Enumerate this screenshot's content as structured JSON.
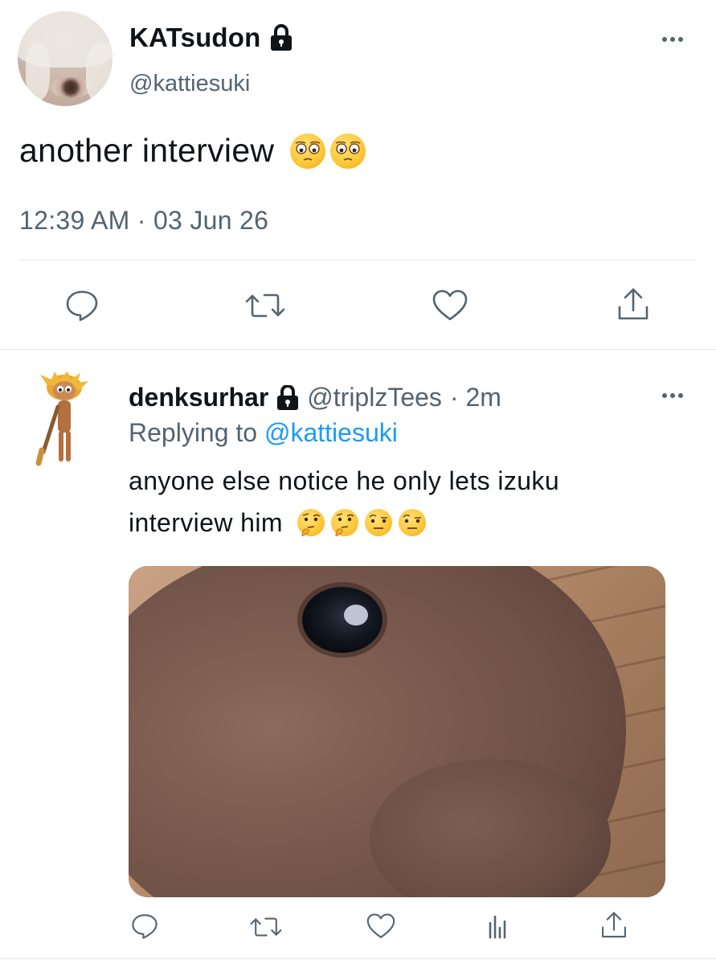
{
  "main_tweet": {
    "display_name": "KATsudon",
    "handle": "@kattiesuki",
    "text": "another interview",
    "emojis": [
      "flushed-face",
      "flushed-face"
    ],
    "timestamp": "12:39 AM · 03 Jun 26",
    "protected": true
  },
  "reply_tweet": {
    "display_name": "denksurhar",
    "handle": "@triplzTees",
    "time": "· 2m",
    "replying_prefix": "Replying to",
    "replying_to": "@kattiesuki",
    "text_line1": "anyone else notice he only lets izuku",
    "text_line2": "interview him",
    "emojis": [
      "thinking-face",
      "thinking-face",
      "raised-eyebrow-face",
      "raised-eyebrow-face"
    ],
    "protected": true
  },
  "colors": {
    "text": "#0f1419",
    "secondary": "#536471",
    "link": "#1d9bf0",
    "divider": "#e1e6ea"
  },
  "icons": {
    "main_actions": [
      "reply-icon",
      "retweet-icon",
      "like-icon",
      "share-icon"
    ],
    "reply_actions": [
      "reply-icon",
      "retweet-icon",
      "like-icon",
      "analytics-icon",
      "share-icon"
    ]
  }
}
